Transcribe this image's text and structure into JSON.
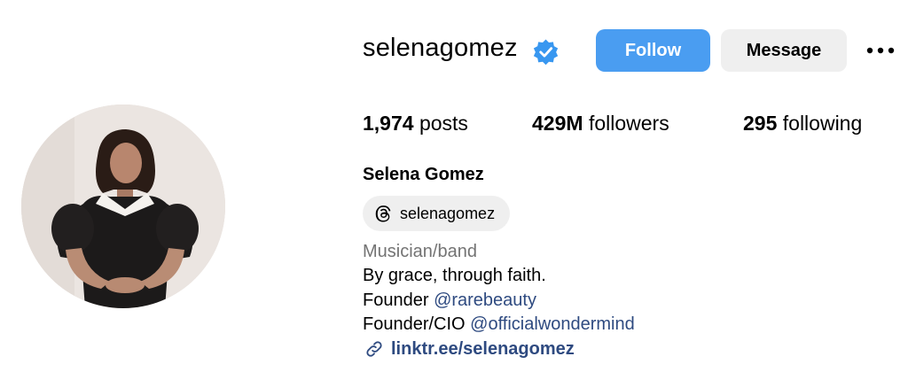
{
  "profile": {
    "username": "selenagomez",
    "display_name": "Selena Gomez",
    "verified": true,
    "verified_color": "#3897f0"
  },
  "actions": {
    "follow_label": "Follow",
    "message_label": "Message",
    "more_icon": "more-horizontal-icon",
    "follow_color": "#4a9df1"
  },
  "stats": {
    "posts": {
      "count": "1,974",
      "label": "posts"
    },
    "followers": {
      "count": "429M",
      "label": "followers"
    },
    "following": {
      "count": "295",
      "label": "following"
    }
  },
  "threads": {
    "handle": "selenagomez",
    "icon": "threads-icon"
  },
  "bio": {
    "category": "Musician/band",
    "line1": "By grace, through faith.",
    "line2_prefix": "Founder",
    "line2_mention": "@rarebeauty",
    "line3_prefix": "Founder/CIO",
    "line3_mention": "@officialwondermind",
    "link_text": "linktr.ee/selenagomez",
    "link_icon": "link-icon",
    "link_color": "#2e4a80"
  }
}
